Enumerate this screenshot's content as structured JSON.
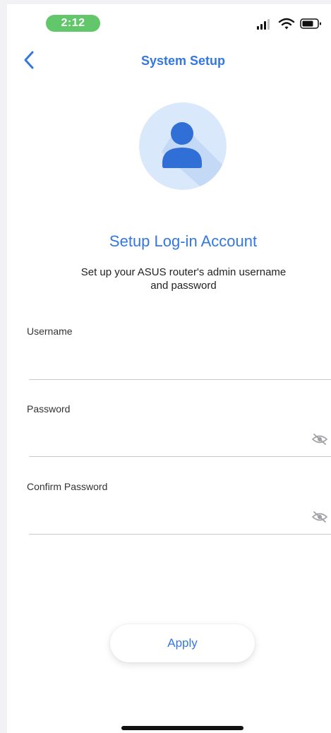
{
  "status_bar": {
    "time": "2:12"
  },
  "nav": {
    "title": "System Setup",
    "back_icon": "chevron-left-icon"
  },
  "avatar_icon": "user-icon",
  "heading": "Setup Log-in Account",
  "subtext_line1": "Set up your ASUS router's admin username",
  "subtext_line2": "and password",
  "fields": {
    "username": {
      "label": "Username",
      "value": ""
    },
    "password": {
      "label": "Password",
      "value": ""
    },
    "confirm_password": {
      "label": "Confirm Password",
      "value": ""
    }
  },
  "apply_label": "Apply",
  "colors": {
    "accent": "#3477e0",
    "time_pill": "#62c76a",
    "avatar_bg": "#d9e8fb"
  }
}
